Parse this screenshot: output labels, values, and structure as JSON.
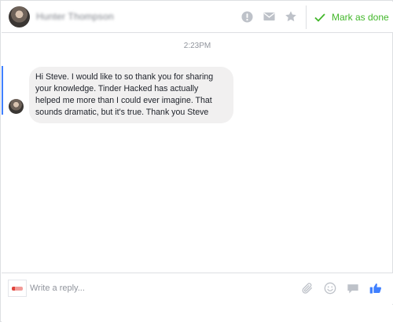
{
  "header": {
    "contact_name": "Hunter Thompson",
    "mark_done_label": "Mark as done",
    "icons": [
      "report-icon",
      "envelope-icon",
      "star-icon",
      "checkmark-icon"
    ]
  },
  "conversation": {
    "timestamp": "2:23PM",
    "message": {
      "text": "Hi Steve. I would like to so thank you for sharing your knowledge. Tinder Hacked has actually helped me more than I could ever imagine. That sounds dramatic, but it's true. Thank you Steve"
    }
  },
  "composer": {
    "placeholder": "Write a reply...",
    "value": "",
    "icons": [
      "paperclip-icon",
      "emoji-icon",
      "sticker-icon",
      "thumbs-up-icon"
    ]
  },
  "colors": {
    "accent_blue": "#4080ff",
    "done_green": "#42b72a",
    "icon_gray": "#bec2c9",
    "bubble_gray": "#f1f0f0"
  }
}
